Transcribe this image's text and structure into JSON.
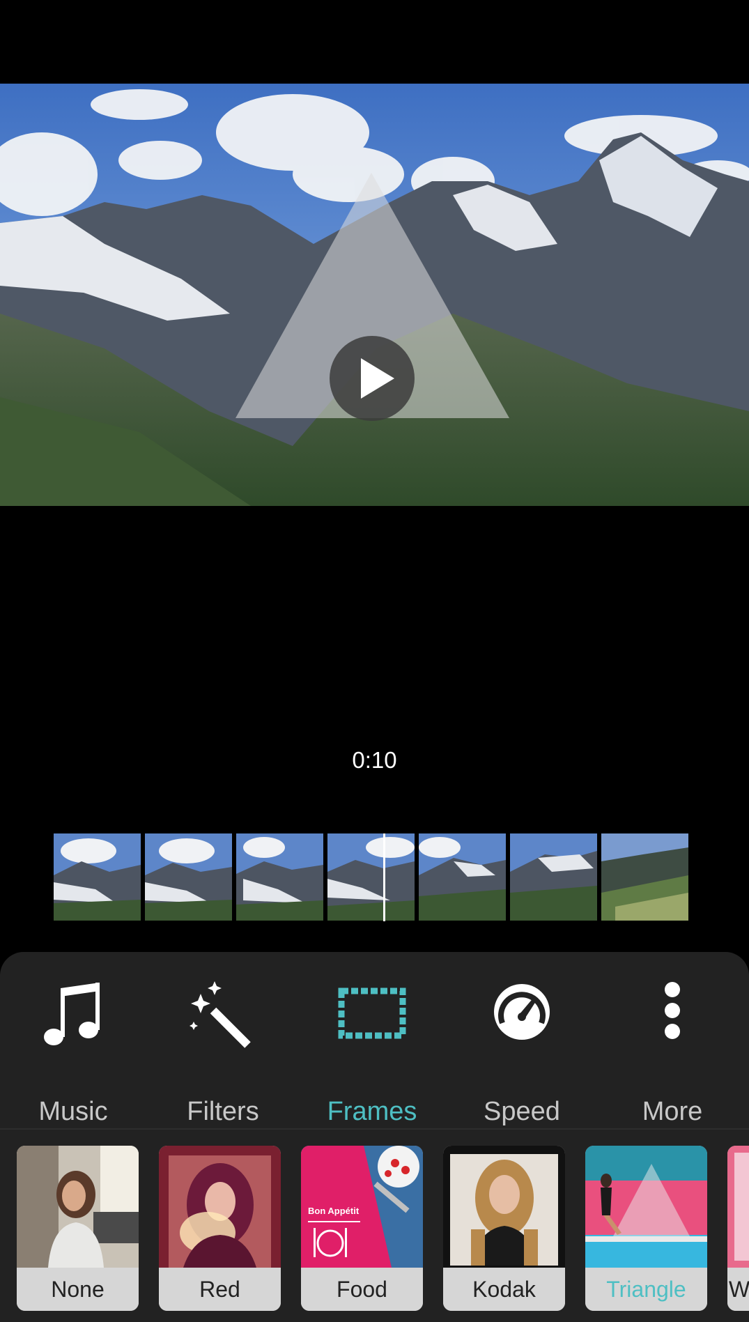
{
  "player": {
    "timestamp": "0:10",
    "play_icon": "play-icon",
    "overlay": "triangle-frame-overlay"
  },
  "timeline": {
    "thumbnail_count": 7
  },
  "toolbar": {
    "items": [
      {
        "label": "Music",
        "icon": "music-note-icon",
        "active": false
      },
      {
        "label": "Filters",
        "icon": "magic-wand-icon",
        "active": false
      },
      {
        "label": "Frames",
        "icon": "frame-icon",
        "active": true
      },
      {
        "label": "Speed",
        "icon": "speedometer-icon",
        "active": false
      },
      {
        "label": "More",
        "icon": "more-vertical-icon",
        "active": false
      }
    ]
  },
  "frames": {
    "items": [
      {
        "label": "None",
        "selected": false
      },
      {
        "label": "Red",
        "selected": false
      },
      {
        "label": "Food",
        "selected": false,
        "overlay_text": "Bon Appétit"
      },
      {
        "label": "Kodak",
        "selected": false
      },
      {
        "label": "Triangle",
        "selected": true
      },
      {
        "label": "W",
        "selected": false
      }
    ]
  },
  "colors": {
    "accent": "#4ebfc3",
    "panel": "#222222",
    "background": "#000000"
  }
}
